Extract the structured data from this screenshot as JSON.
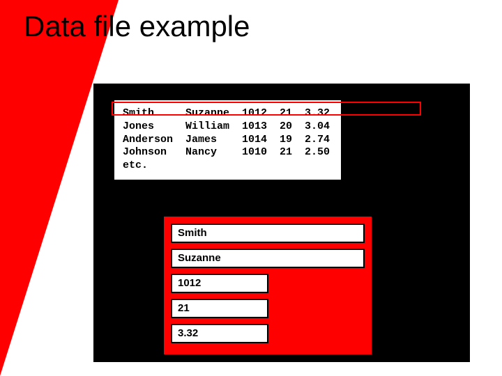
{
  "title": "Data file example",
  "datafile": {
    "rows": [
      {
        "c0": "Smith",
        "c1": "Suzanne",
        "c2": "1012",
        "c3": "21",
        "c4": "3.32"
      },
      {
        "c0": "Jones",
        "c1": "William",
        "c2": "1013",
        "c3": "20",
        "c4": "3.04"
      },
      {
        "c0": "Anderson",
        "c1": "James",
        "c2": "1014",
        "c3": "19",
        "c4": "2.74"
      },
      {
        "c0": "Johnson",
        "c1": "Nancy",
        "c2": "1010",
        "c3": "21",
        "c4": "2.50"
      },
      {
        "c0": "etc.",
        "c1": "",
        "c2": "",
        "c3": "",
        "c4": ""
      }
    ]
  },
  "record": {
    "lastname": "Smith",
    "firstname": "Suzanne",
    "id": "1012",
    "age": "21",
    "gpa": "3.32"
  }
}
